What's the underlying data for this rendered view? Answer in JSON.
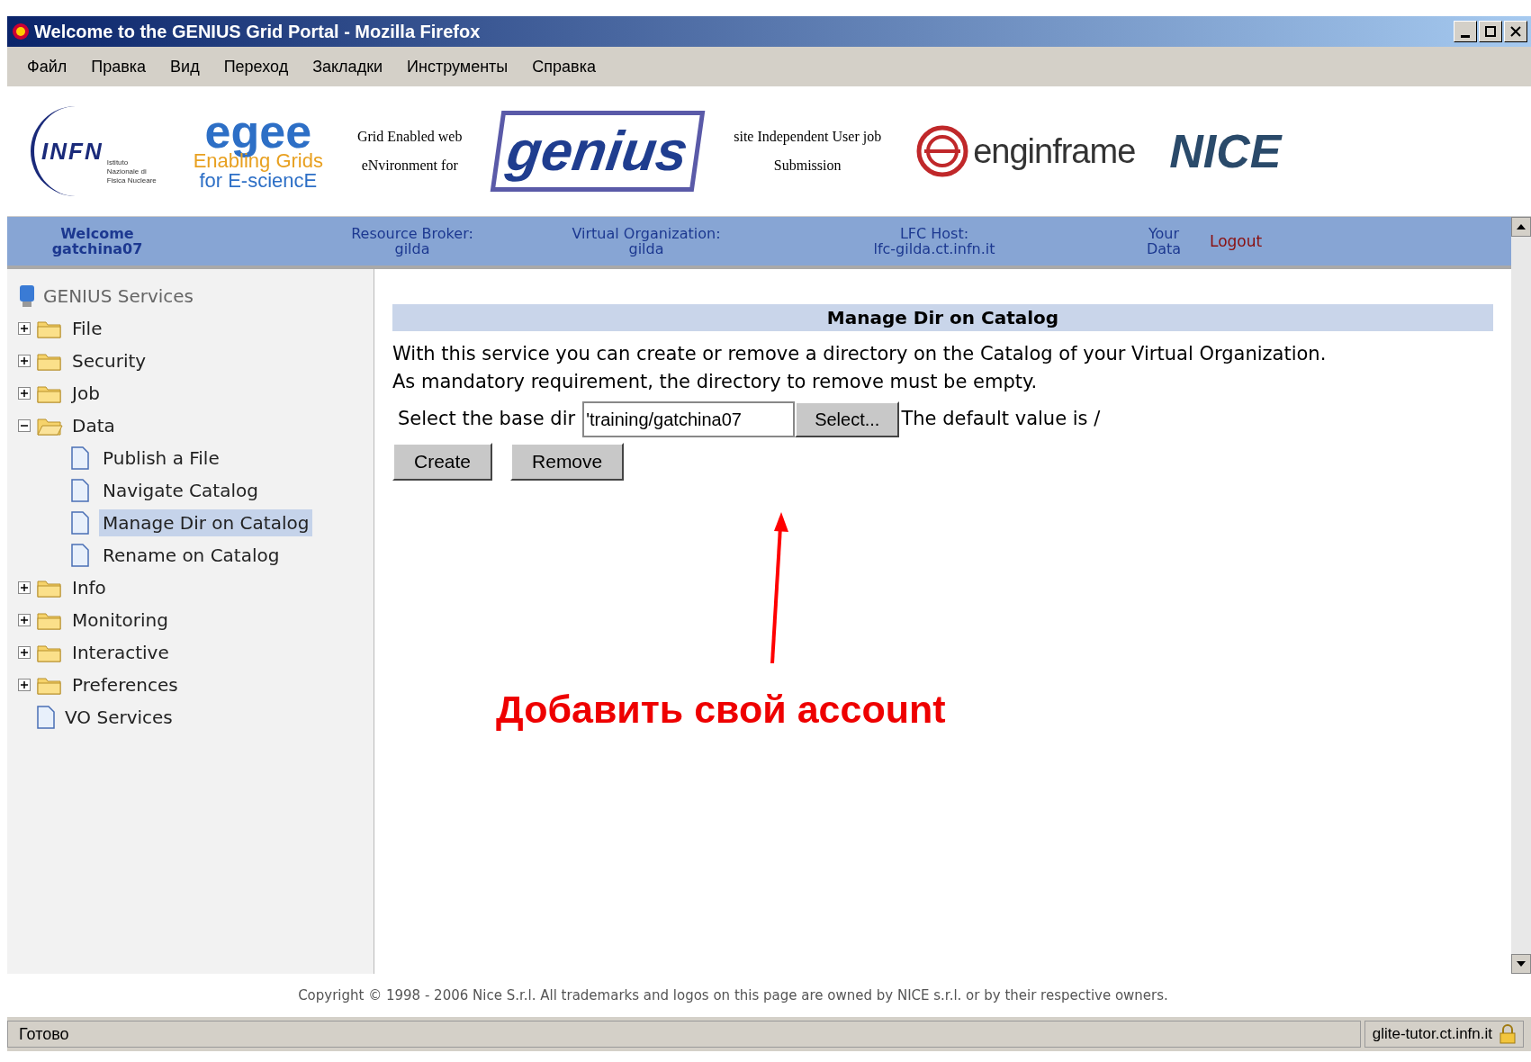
{
  "window": {
    "title": "Welcome to the GENIUS Grid Portal - Mozilla Firefox"
  },
  "menu": [
    "Файл",
    "Правка",
    "Вид",
    "Переход",
    "Закладки",
    "Инструменты",
    "Справка"
  ],
  "header": {
    "infn": {
      "name": "INFN",
      "subtitle": "Istituto Nazionale di Fisica Nucleare"
    },
    "egee": {
      "name": "egee",
      "line_1": "Enabling Grids",
      "line_2": "for E-sciencE"
    },
    "tagline_left": {
      "line_1": "Grid Enabled web",
      "line_2": "eNvironment for"
    },
    "genius": "genius",
    "tagline_right": {
      "line_1": "site Independent User job",
      "line_2": "Submission"
    },
    "enginframe": "enginframe",
    "nice": "NICE"
  },
  "nav": [
    {
      "label": "Welcome",
      "value": "gatchina07",
      "kind": "bold"
    },
    {
      "label": "Resource Broker:",
      "value": "gilda",
      "kind": "plain"
    },
    {
      "label": "Virtual Organization:",
      "value": "gilda",
      "kind": "plain"
    },
    {
      "label": "LFC Host:",
      "value": "lfc-gilda.ct.infn.it",
      "kind": "plain"
    },
    {
      "label": "Your",
      "value": "Data",
      "kind": "plain"
    }
  ],
  "logout": "Logout",
  "sidebar": {
    "title": "GENIUS Services",
    "items": [
      {
        "label": "File",
        "kind": "folder",
        "expanded": false,
        "selected": false
      },
      {
        "label": "Security",
        "kind": "folder",
        "expanded": false,
        "selected": false
      },
      {
        "label": "Job",
        "kind": "folder",
        "expanded": false,
        "selected": false
      },
      {
        "label": "Data",
        "kind": "folder",
        "expanded": true,
        "selected": false,
        "children": [
          {
            "label": "Publish a File",
            "kind": "page",
            "selected": false
          },
          {
            "label": "Navigate Catalog",
            "kind": "page",
            "selected": false
          },
          {
            "label": "Manage Dir on Catalog",
            "kind": "page",
            "selected": true
          },
          {
            "label": "Rename on Catalog",
            "kind": "page",
            "selected": false
          }
        ]
      },
      {
        "label": "Info",
        "kind": "folder",
        "expanded": false,
        "selected": false
      },
      {
        "label": "Monitoring",
        "kind": "folder",
        "expanded": false,
        "selected": false
      },
      {
        "label": "Interactive",
        "kind": "folder",
        "expanded": false,
        "selected": false
      },
      {
        "label": "Preferences",
        "kind": "folder",
        "expanded": false,
        "selected": false
      },
      {
        "label": "VO Services",
        "kind": "page",
        "selected": false
      }
    ]
  },
  "content": {
    "heading": "Manage Dir on Catalog",
    "paragraphs": [
      "With this service you can create or remove a directory on the Catalog of your Virtual Organization.",
      "As mandatory requirement, the directory to remove must be empty."
    ],
    "base_dir": {
      "label": "Select the base dir",
      "value": "'training/gatchina07",
      "button": "Select...",
      "note": "The default value is /"
    },
    "buttons": [
      "Create",
      "Remove"
    ],
    "annotation": "Добавить свой account"
  },
  "footer": "Copyright © 1998 - 2006 Nice S.r.l. All trademarks and logos on this page are owned by NICE s.r.l. or by their respective owners.",
  "status_bar": {
    "text": "Готово",
    "host": "glite-tutor.ct.infn.it"
  }
}
